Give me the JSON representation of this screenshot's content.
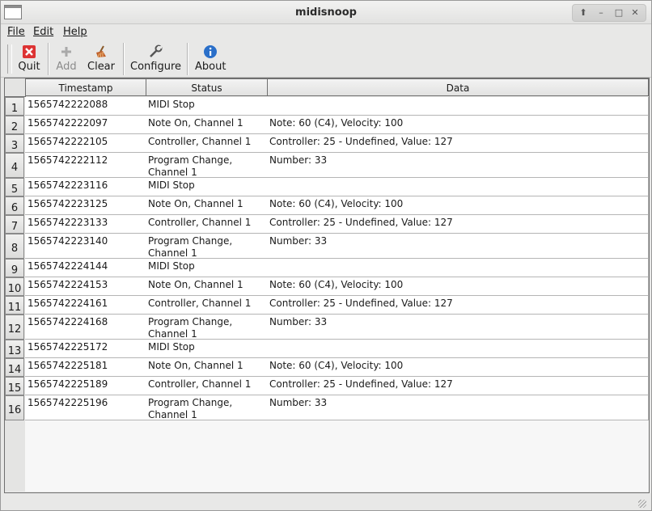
{
  "window": {
    "title": "midisnoop"
  },
  "menu": {
    "file": "File",
    "edit": "Edit",
    "help": "Help"
  },
  "toolbar": {
    "quit": "Quit",
    "add": "Add",
    "clear": "Clear",
    "configure": "Configure",
    "about": "About",
    "icons": {
      "quit": "quit-x-icon",
      "add": "plus-icon",
      "clear": "broom-icon",
      "configure": "wrench-icon",
      "about": "info-icon"
    }
  },
  "table": {
    "columns": [
      "Timestamp",
      "Status",
      "Data"
    ],
    "rows": [
      {
        "n": "1",
        "timestamp": "1565742222088",
        "status": "MIDI Stop",
        "data": ""
      },
      {
        "n": "2",
        "timestamp": "1565742222097",
        "status": "Note On, Channel 1",
        "data": "Note: 60 (C4), Velocity: 100"
      },
      {
        "n": "3",
        "timestamp": "1565742222105",
        "status": "Controller, Channel 1",
        "data": "Controller: 25 - Undefined, Value: 127"
      },
      {
        "n": "4",
        "timestamp": "1565742222112",
        "status": "Program Change, Channel 1",
        "data": "Number: 33"
      },
      {
        "n": "5",
        "timestamp": "1565742223116",
        "status": "MIDI Stop",
        "data": ""
      },
      {
        "n": "6",
        "timestamp": "1565742223125",
        "status": "Note On, Channel 1",
        "data": "Note: 60 (C4), Velocity: 100"
      },
      {
        "n": "7",
        "timestamp": "1565742223133",
        "status": "Controller, Channel 1",
        "data": "Controller: 25 - Undefined, Value: 127"
      },
      {
        "n": "8",
        "timestamp": "1565742223140",
        "status": "Program Change, Channel 1",
        "data": "Number: 33"
      },
      {
        "n": "9",
        "timestamp": "1565742224144",
        "status": "MIDI Stop",
        "data": ""
      },
      {
        "n": "10",
        "timestamp": "1565742224153",
        "status": "Note On, Channel 1",
        "data": "Note: 60 (C4), Velocity: 100"
      },
      {
        "n": "11",
        "timestamp": "1565742224161",
        "status": "Controller, Channel 1",
        "data": "Controller: 25 - Undefined, Value: 127"
      },
      {
        "n": "12",
        "timestamp": "1565742224168",
        "status": "Program Change, Channel 1",
        "data": "Number: 33"
      },
      {
        "n": "13",
        "timestamp": "1565742225172",
        "status": "MIDI Stop",
        "data": ""
      },
      {
        "n": "14",
        "timestamp": "1565742225181",
        "status": "Note On, Channel 1",
        "data": "Note: 60 (C4), Velocity: 100"
      },
      {
        "n": "15",
        "timestamp": "1565742225189",
        "status": "Controller, Channel 1",
        "data": "Controller: 25 - Undefined, Value: 127"
      },
      {
        "n": "16",
        "timestamp": "1565742225196",
        "status": "Program Change, Channel 1",
        "data": "Number: 33"
      }
    ]
  }
}
